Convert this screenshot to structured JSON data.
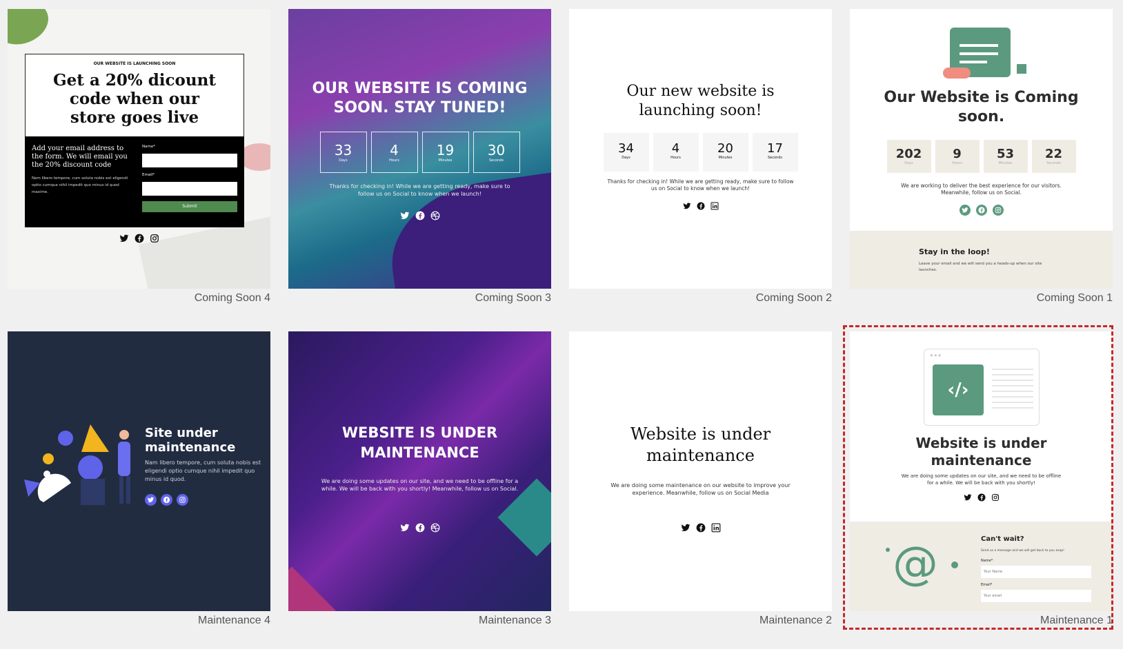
{
  "colors": {
    "selection": "#c62828",
    "green": "#5b9a7e",
    "navy": "#22304a",
    "purple": "#6b46c1"
  },
  "cards": {
    "cs4": {
      "caption": "Coming Soon 4",
      "kicker": "OUR WEBSITE IS LAUNCHING SOON",
      "title_l1": "Get a 20% dicount",
      "title_l2": "code when our",
      "title_l3": "store goes live",
      "intro": "Add your email address to the form. We will email you the 20% discount code",
      "body": "Nam libero tempore, cum soluta nobis est eligendi optio cumque nihil impedit quo minus id quod maxime.",
      "name_label": "Name*",
      "email_label": "Email*",
      "submit": "Submit",
      "icons": [
        "twitter-icon",
        "facebook-icon",
        "instagram-icon"
      ]
    },
    "cs3": {
      "caption": "Coming Soon 3",
      "title_l1": "OUR WEBSITE IS COMING",
      "title_l2": "SOON. STAY TUNED!",
      "countdown": [
        {
          "value": "33",
          "label": "Days"
        },
        {
          "value": "4",
          "label": "Hours"
        },
        {
          "value": "19",
          "label": "Minutes"
        },
        {
          "value": "30",
          "label": "Seconds"
        }
      ],
      "text": "Thanks for checking in! While we are getting ready, make sure to follow us on Social to know when we launch!",
      "icons": [
        "twitter-icon",
        "facebook-icon",
        "dribbble-icon"
      ]
    },
    "cs2": {
      "caption": "Coming Soon 2",
      "title_l1": "Our new website is",
      "title_l2": "launching soon!",
      "countdown": [
        {
          "value": "34",
          "label": "Days"
        },
        {
          "value": "4",
          "label": "Hours"
        },
        {
          "value": "20",
          "label": "Minutes"
        },
        {
          "value": "17",
          "label": "Seconds"
        }
      ],
      "text": "Thanks for checking in! While we are getting ready, make sure to follow us on Social to know when we launch!",
      "icons": [
        "twitter-icon",
        "facebook-icon",
        "linkedin-icon"
      ]
    },
    "cs1": {
      "caption": "Coming Soon 1",
      "title_l1": "Our Website is Coming",
      "title_l2": "soon.",
      "countdown": [
        {
          "value": "202",
          "label": "Days"
        },
        {
          "value": "9",
          "label": "Hours"
        },
        {
          "value": "53",
          "label": "Minutes"
        },
        {
          "value": "22",
          "label": "Seconds"
        }
      ],
      "text": "We are working to deliver the best experience for our visitors. Meanwhile, follow us on Social.",
      "loop_title": "Stay in the loop!",
      "loop_text": "Leave your email and we will send you a heads-up when our site launches.",
      "icons": [
        "twitter-icon",
        "facebook-icon",
        "instagram-icon"
      ]
    },
    "m4": {
      "caption": "Maintenance 4",
      "title_l1": "Site under",
      "title_l2": "maintenance",
      "text": "Nam libero tempore, cum soluta nobis est eligendi optio cumque nihil impedit quo minus id quod.",
      "icons": [
        "twitter-icon",
        "facebook-icon",
        "instagram-icon"
      ]
    },
    "m3": {
      "caption": "Maintenance 3",
      "title_l1": "WEBSITE IS UNDER",
      "title_l2": "MAINTENANCE",
      "text": "We are doing some updates on our site, and we need to be offline for a while. We will be back with you shortly! Meanwhile, follow us on Social.",
      "icons": [
        "twitter-icon",
        "facebook-icon",
        "dribbble-icon"
      ]
    },
    "m2": {
      "caption": "Maintenance 2",
      "title_l1": "Website is under",
      "title_l2": "maintenance",
      "text": "We are doing some maintenance on our website to improve your experience. Meanwhile, follow us on Social Media",
      "icons": [
        "twitter-icon",
        "facebook-icon",
        "linkedin-icon"
      ]
    },
    "m1": {
      "caption": "Maintenance 1",
      "title_l1": "Website is under",
      "title_l2": "maintenance",
      "text": "We are doing some updates on our site, and we need to be offline for a while. We will be back with you shortly!",
      "wait_title": "Can't wait?",
      "wait_text": "Send us a message and we will get back to you asap!",
      "name_label": "Name*",
      "name_ph": "Your Name",
      "email_label": "Email*",
      "email_ph": "Your email",
      "icons": [
        "twitter-icon",
        "facebook-icon",
        "instagram-icon"
      ]
    }
  }
}
